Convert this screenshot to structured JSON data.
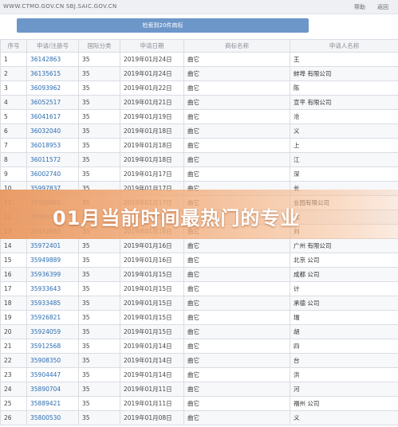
{
  "topbar": {
    "url": "WWW.CTMO.GOV.CN  SBJ.SAIC.GOV.CN",
    "help": "帮助",
    "back": "返回"
  },
  "result_bar": "检索到20件商标",
  "table": {
    "headers": [
      "序号",
      "申请/注册号",
      "国际分类",
      "申请日期",
      "商标名称",
      "申请人名称"
    ],
    "rows": [
      [
        "1",
        "36142863",
        "35",
        "2019年01月24日",
        "曲它",
        "王"
      ],
      [
        "2",
        "36135615",
        "35",
        "2019年01月24日",
        "曲它",
        "蚌埠                有限公司"
      ],
      [
        "3",
        "36093962",
        "35",
        "2019年01月22日",
        "曲它",
        "陈"
      ],
      [
        "4",
        "36052517",
        "35",
        "2019年01月21日",
        "曲它",
        "宣平              有限公司"
      ],
      [
        "5",
        "36041617",
        "35",
        "2019年01月19日",
        "曲它",
        "沧"
      ],
      [
        "6",
        "36032040",
        "35",
        "2019年01月18日",
        "曲它",
        "义"
      ],
      [
        "7",
        "36018953",
        "35",
        "2019年01月18日",
        "曲它",
        "上"
      ],
      [
        "8",
        "36011572",
        "35",
        "2019年01月18日",
        "曲它",
        "江"
      ],
      [
        "9",
        "36002740",
        "35",
        "2019年01月17日",
        "曲它",
        "深"
      ],
      [
        "10",
        "35997837",
        "35",
        "2019年01月17日",
        "曲它",
        "长"
      ],
      [
        "11",
        "35990881",
        "35",
        "2019年01月17日",
        "曲它",
        "业园有限公司"
      ],
      [
        "12",
        "35986012",
        "35",
        "2019年01月17日",
        "曲它",
        "北"
      ],
      [
        "13",
        "35972663",
        "35",
        "2019年01月16日",
        "曲它",
        "刘"
      ],
      [
        "14",
        "35972401",
        "35",
        "2019年01月16日",
        "曲它",
        "广州            有限公司"
      ],
      [
        "15",
        "35949889",
        "35",
        "2019年01月16日",
        "曲它",
        "北京              公司"
      ],
      [
        "16",
        "35936399",
        "35",
        "2019年01月15日",
        "曲它",
        "成都              公司"
      ],
      [
        "17",
        "35933643",
        "35",
        "2019年01月15日",
        "曲它",
        "计"
      ],
      [
        "18",
        "35933485",
        "35",
        "2019年01月15日",
        "曲它",
        "承德              公司"
      ],
      [
        "19",
        "35926821",
        "35",
        "2019年01月15日",
        "曲它",
        "瑞"
      ],
      [
        "20",
        "35924059",
        "35",
        "2019年01月15日",
        "曲它",
        "胡"
      ],
      [
        "21",
        "35912568",
        "35",
        "2019年01月14日",
        "曲它",
        "四"
      ],
      [
        "22",
        "35908350",
        "35",
        "2019年01月14日",
        "曲它",
        "台"
      ],
      [
        "23",
        "35904447",
        "35",
        "2019年01月14日",
        "曲它",
        "洪"
      ],
      [
        "24",
        "35890704",
        "35",
        "2019年01月11日",
        "曲它",
        "河"
      ],
      [
        "25",
        "35889421",
        "35",
        "2019年01月11日",
        "曲它",
        "福州              公司"
      ],
      [
        "26",
        "35800530",
        "35",
        "2019年01月08日",
        "曲它",
        "义"
      ]
    ]
  },
  "banner": {
    "title": "01月当前时间最热门的专业"
  }
}
